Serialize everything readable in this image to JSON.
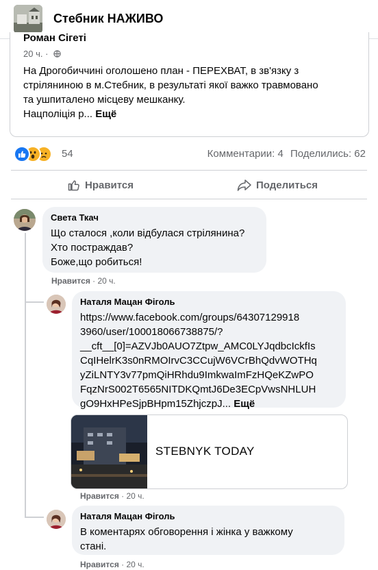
{
  "group": {
    "title": "Стебник НАЖИВО"
  },
  "post": {
    "author": "Роман Сігеті",
    "time": "20 ч.",
    "lines": [
      "На Дрогобиччині  оголошено план - ПЕРЕХВАТ, в зв'язку з",
      "стріляниною в м.Стебник, в результаті якої важко травмовано",
      "та ушпиталено місцеву мешканку.",
      "Нацполіція р..."
    ],
    "more": "Ещё"
  },
  "stats": {
    "reactions_count": "54",
    "reaction_icons": [
      "like-icon",
      "wow-icon",
      "sad-icon"
    ],
    "comments": "Комментарии: 4",
    "shares": "Поделились: 62"
  },
  "actions": {
    "like": "Нравится",
    "share": "Поделиться"
  },
  "comments": [
    {
      "name": "Света Ткач",
      "lines": [
        "Що сталося ,коли відбулася стрілянина?",
        "Хто постраждав?",
        "Боже,що робиться!"
      ],
      "like": "Нравится",
      "time": "20 ч."
    },
    {
      "name": "Наталя Мацан Фіголь",
      "lines": [
        "https://www.facebook.com/groups/64307129918",
        "3960/user/100018066738875/?",
        "__cft__[0]=AZVJb0AUO7Ztpw_AMC0LYJqdbcIckfIs",
        "CqIHelrK3s0nRMOIrvC3CCujW6VCrBhQdvWOTHq",
        "yZiLNTY3v77pmQiHRhdu9ImkwaImFzHQeKZwPO",
        "FqzNrS002T6565NITDKQmtJ6De3ECpVwsNHLUH",
        "gO9HxHPeSjpBHpm15ZhjczpJ..."
      ],
      "more": "Ещё",
      "link_preview_title": "STEBNYK TODAY",
      "like": "Нравится",
      "time": "20 ч."
    },
    {
      "name": "Наталя Мацан Фіголь",
      "lines": [
        "В коментарях обговорення і жінка у важкому",
        "стані."
      ],
      "like": "Нравится",
      "time": "20 ч."
    }
  ],
  "colors": {
    "accent": "#1877f2",
    "secondary_text": "#65676b",
    "bubble": "#f0f2f5"
  }
}
